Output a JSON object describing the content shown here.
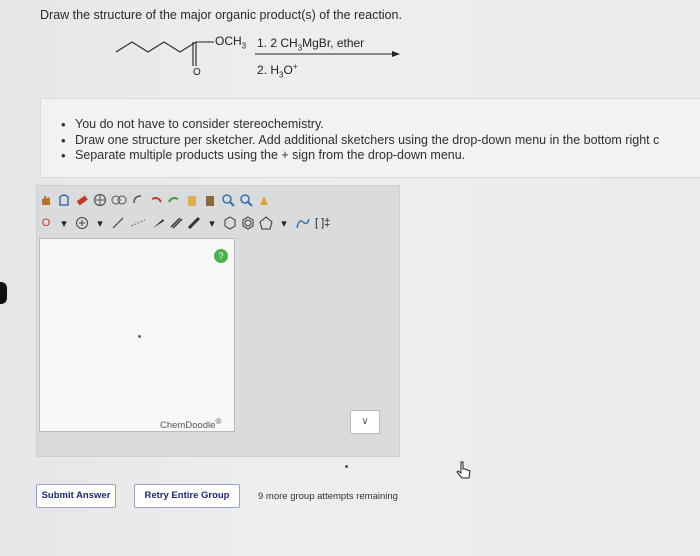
{
  "question": "Draw the structure of the major organic product(s) of the reaction.",
  "reaction": {
    "substituent": "OCH",
    "substituent_sub": "3",
    "carbonyl_o": "O",
    "reagent1_prefix": "1.  2 CH",
    "reagent1_sub": "3",
    "reagent1_suffix": "MgBr, ether",
    "reagent2_prefix": "2. H",
    "reagent2_sub": "3",
    "reagent2_o": "O",
    "reagent2_sup": "+"
  },
  "instructions": [
    "You do not have to consider stereochemistry.",
    "Draw one structure per sketcher. Add additional sketchers using the drop-down menu in the bottom right c",
    "Separate multiple products using the + sign from the drop-down menu."
  ],
  "sketcher": {
    "atom_label": "O",
    "help_label": "?",
    "brand": "ChemDoodle",
    "brand_mark": "®",
    "bracket_label": "[ ]‡",
    "dropdown_glyph": "▾",
    "select_glyph": "∨"
  },
  "buttons": {
    "submit": "Submit Answer",
    "retry": "Retry Entire Group"
  },
  "attempts_text": "9 more group attempts remaining",
  "colors": {
    "button_text": "#1d2a6b",
    "help": "#4caf50",
    "background": "#e7e9ea"
  }
}
